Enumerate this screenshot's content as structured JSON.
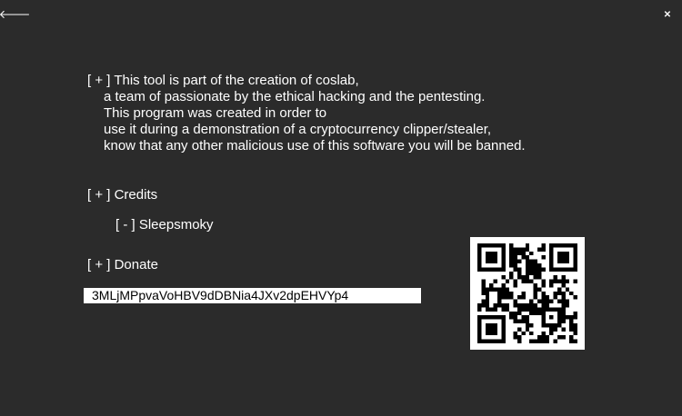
{
  "window": {
    "back_icon": "arrow-left-icon",
    "back_glyph": "🡐",
    "close_icon": "close-icon",
    "close_glyph": "✕"
  },
  "about": {
    "lines": [
      "[ + ] This tool is part of the creation of coslab,",
      "a team of passionate by the ethical hacking and the pentesting.",
      "This program was created in order to",
      "use it during a demonstration of a cryptocurrency clipper/stealer,",
      "know that any other malicious use of this software you will be banned."
    ]
  },
  "credits": {
    "heading": "[ + ] Credits",
    "items": [
      "[ - ] Sleepsmoky"
    ]
  },
  "donate": {
    "heading": "[ + ] Donate",
    "address": "3MLjMPpvaVoHBV9dDBNia4JXv2dpEHVYp4",
    "qr_icon": "qr-code-icon"
  },
  "colors": {
    "background": "#2b2b2b",
    "text": "#ffffff",
    "field_bg": "#ffffff",
    "field_text": "#000000"
  }
}
